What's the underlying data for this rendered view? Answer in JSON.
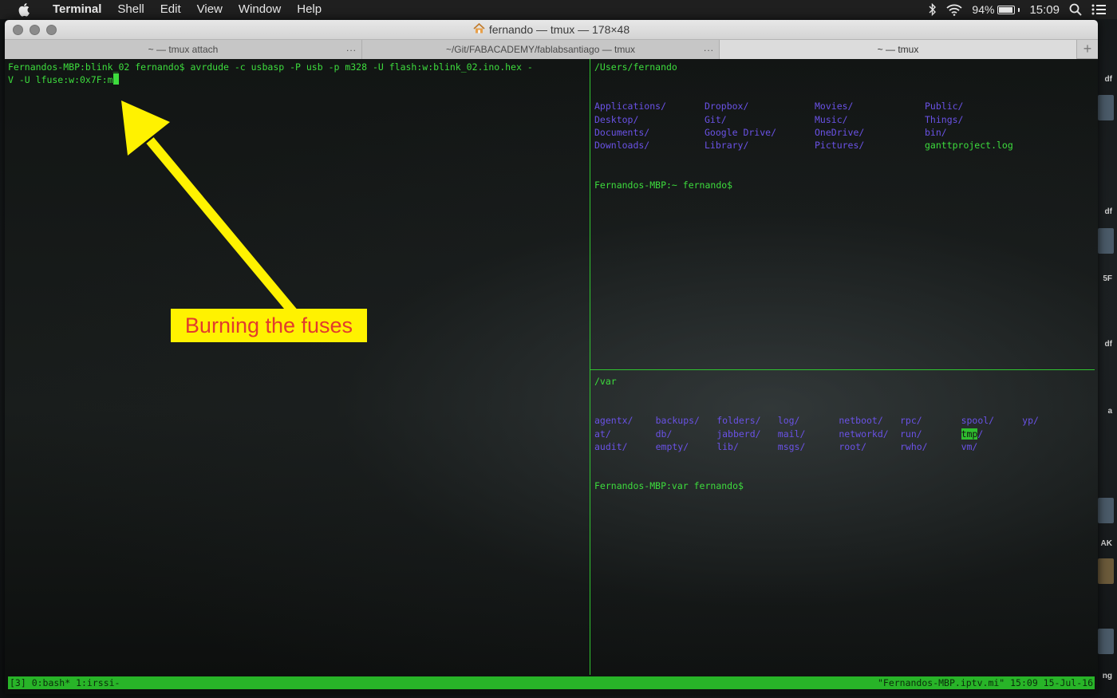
{
  "menubar": {
    "app": "Terminal",
    "items": [
      "Shell",
      "Edit",
      "View",
      "Window",
      "Help"
    ],
    "battery": "94%",
    "battery_level": 0.94,
    "time": "15:09"
  },
  "window": {
    "title": "fernando — tmux — 178×48",
    "tabs": [
      {
        "label": "~ — tmux attach",
        "more": "...",
        "active": false
      },
      {
        "label": "~/Git/FABACADEMY/fablabsantiago — tmux",
        "more": "...",
        "active": false
      },
      {
        "label": "~ — tmux",
        "more": "",
        "active": true
      }
    ],
    "add_tab": "+"
  },
  "left_pane": {
    "lines": [
      "Fernandos-MBP:blink_02 fernando$ avrdude -c usbasp -P usb -p m328 -U flash:w:blink_02.ino.hex -",
      "V -U lfuse:w:0x7F:m"
    ]
  },
  "top_right_pane": {
    "path": "/Users/fernando",
    "entries": [
      {
        "name": "Applications/",
        "kind": "dir"
      },
      {
        "name": "Dropbox/",
        "kind": "dir"
      },
      {
        "name": "Movies/",
        "kind": "dir"
      },
      {
        "name": "Public/",
        "kind": "dir"
      },
      {
        "name": "Desktop/",
        "kind": "dir"
      },
      {
        "name": "Git/",
        "kind": "dir"
      },
      {
        "name": "Music/",
        "kind": "dir"
      },
      {
        "name": "Things/",
        "kind": "dir"
      },
      {
        "name": "Documents/",
        "kind": "dir"
      },
      {
        "name": "Google Drive/",
        "kind": "dir"
      },
      {
        "name": "OneDrive/",
        "kind": "dir"
      },
      {
        "name": "bin/",
        "kind": "dir"
      },
      {
        "name": "Downloads/",
        "kind": "dir"
      },
      {
        "name": "Library/",
        "kind": "dir"
      },
      {
        "name": "Pictures/",
        "kind": "dir"
      },
      {
        "name": "ganttproject.log",
        "kind": "file"
      }
    ],
    "prompt": "Fernandos-MBP:~ fernando$"
  },
  "bottom_right_pane": {
    "path": "/var",
    "entries": [
      {
        "name": "agentx/",
        "kind": "dir"
      },
      {
        "name": "backups/",
        "kind": "dir"
      },
      {
        "name": "folders/",
        "kind": "dir"
      },
      {
        "name": "log/",
        "kind": "dir"
      },
      {
        "name": "netboot/",
        "kind": "dir"
      },
      {
        "name": "rpc/",
        "kind": "dir"
      },
      {
        "name": "spool/",
        "kind": "dir"
      },
      {
        "name": "yp/",
        "kind": "dir"
      },
      {
        "name": "at/",
        "kind": "dir"
      },
      {
        "name": "db/",
        "kind": "dir"
      },
      {
        "name": "jabberd/",
        "kind": "dir"
      },
      {
        "name": "mail/",
        "kind": "dir"
      },
      {
        "name": "networkd/",
        "kind": "dir"
      },
      {
        "name": "run/",
        "kind": "dir"
      },
      {
        "name": "tmp/",
        "kind": "highlight"
      },
      {
        "name": "",
        "kind": "dir"
      },
      {
        "name": "audit/",
        "kind": "dir"
      },
      {
        "name": "empty/",
        "kind": "dir"
      },
      {
        "name": "lib/",
        "kind": "dir"
      },
      {
        "name": "msgs/",
        "kind": "dir"
      },
      {
        "name": "root/",
        "kind": "dir"
      },
      {
        "name": "rwho/",
        "kind": "dir"
      },
      {
        "name": "vm/",
        "kind": "dir"
      },
      {
        "name": "",
        "kind": "dir"
      }
    ],
    "prompt": "Fernandos-MBP:var fernando$"
  },
  "statusbar": {
    "left": "[3] 0:bash* 1:irssi-",
    "right": "\"Fernandos-MBP.iptv.mi\" 15:09 15-Jul-16"
  },
  "annotation": {
    "label": "Burning the fuses"
  },
  "desktop_labels": [
    "df",
    "df",
    "5F",
    "df",
    "a",
    "AK",
    "ng"
  ],
  "colors": {
    "terminal_text": "#3ddc3d",
    "directory": "#6a52e6",
    "status_bar": "#28b428",
    "callout_bg": "#fff200",
    "callout_text": "#e23b2d",
    "arrow": "#fff200"
  }
}
